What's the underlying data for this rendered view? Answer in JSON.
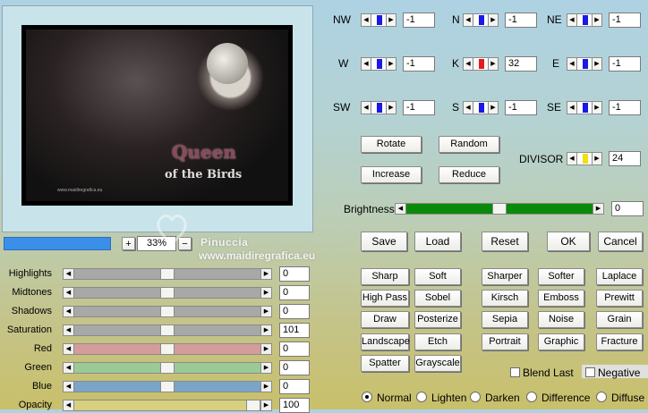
{
  "preview": {
    "art_title_line1": "Queen",
    "art_title_line2": "of the Birds",
    "art_credit": "www.maidiregrafica.eu"
  },
  "zoom": {
    "progress": 1.0,
    "minus": "−",
    "plus": "+",
    "value": "33%"
  },
  "watermark": {
    "name": "Pinuccia",
    "url": "www.maidiregrafica.eu"
  },
  "sliders": [
    {
      "label": "Highlights",
      "value": "0",
      "pos": 0.5,
      "color": "#a8a8a8"
    },
    {
      "label": "Midtones",
      "value": "0",
      "pos": 0.5,
      "color": "#a8a8a8"
    },
    {
      "label": "Shadows",
      "value": "0",
      "pos": 0.5,
      "color": "#a8a8a8"
    },
    {
      "label": "Saturation",
      "value": "101",
      "pos": 0.5,
      "color": "#a8a8a8"
    },
    {
      "label": "Red",
      "value": "0",
      "pos": 0.5,
      "color": "#d59c9c"
    },
    {
      "label": "Green",
      "value": "0",
      "pos": 0.5,
      "color": "#9acb96"
    },
    {
      "label": "Blue",
      "value": "0",
      "pos": 0.5,
      "color": "#7aa5c8"
    },
    {
      "label": "Opacity",
      "value": "100",
      "pos": 1.0,
      "color": "#d8d080"
    }
  ],
  "matrix": [
    {
      "label": "NW",
      "value": "-1",
      "indicator": "#1a1ae6"
    },
    {
      "label": "N",
      "value": "-1",
      "indicator": "#1a1ae6"
    },
    {
      "label": "NE",
      "value": "-1",
      "indicator": "#1a1ae6"
    },
    {
      "label": "W",
      "value": "-1",
      "indicator": "#1a1ae6"
    },
    {
      "label": "K",
      "value": "32",
      "indicator": "#e61a1a"
    },
    {
      "label": "E",
      "value": "-1",
      "indicator": "#1a1ae6"
    },
    {
      "label": "SW",
      "value": "-1",
      "indicator": "#1a1ae6"
    },
    {
      "label": "S",
      "value": "-1",
      "indicator": "#1a1ae6"
    },
    {
      "label": "SE",
      "value": "-1",
      "indicator": "#1a1ae6"
    }
  ],
  "ops": {
    "rotate": "Rotate",
    "random": "Random",
    "increase": "Increase",
    "reduce": "Reduce"
  },
  "divisor": {
    "label": "DIVISOR",
    "value": "24",
    "indicator": "#f0e010"
  },
  "brightness": {
    "label": "Brightness",
    "value": "0",
    "pos": 0.5,
    "color": "#0a8a0a"
  },
  "actions": {
    "save": "Save",
    "load": "Load",
    "reset": "Reset",
    "ok": "OK",
    "cancel": "Cancel"
  },
  "presets": [
    "Sharp",
    "Soft",
    "Sharper",
    "Softer",
    "Laplace",
    "High Pass",
    "Sobel",
    "Kirsch",
    "Emboss",
    "Prewitt",
    "Draw",
    "Posterize",
    "Sepia",
    "Noise",
    "Grain",
    "Landscape",
    "Etch",
    "Portrait",
    "Graphic",
    "Fracture",
    "Spatter",
    "Grayscale"
  ],
  "options": {
    "blend_last": "Blend Last",
    "negative": "Negative"
  },
  "modes": [
    {
      "label": "Normal",
      "selected": true
    },
    {
      "label": "Lighten",
      "selected": false
    },
    {
      "label": "Darken",
      "selected": false
    },
    {
      "label": "Difference",
      "selected": false
    },
    {
      "label": "Diffuse",
      "selected": false
    }
  ]
}
